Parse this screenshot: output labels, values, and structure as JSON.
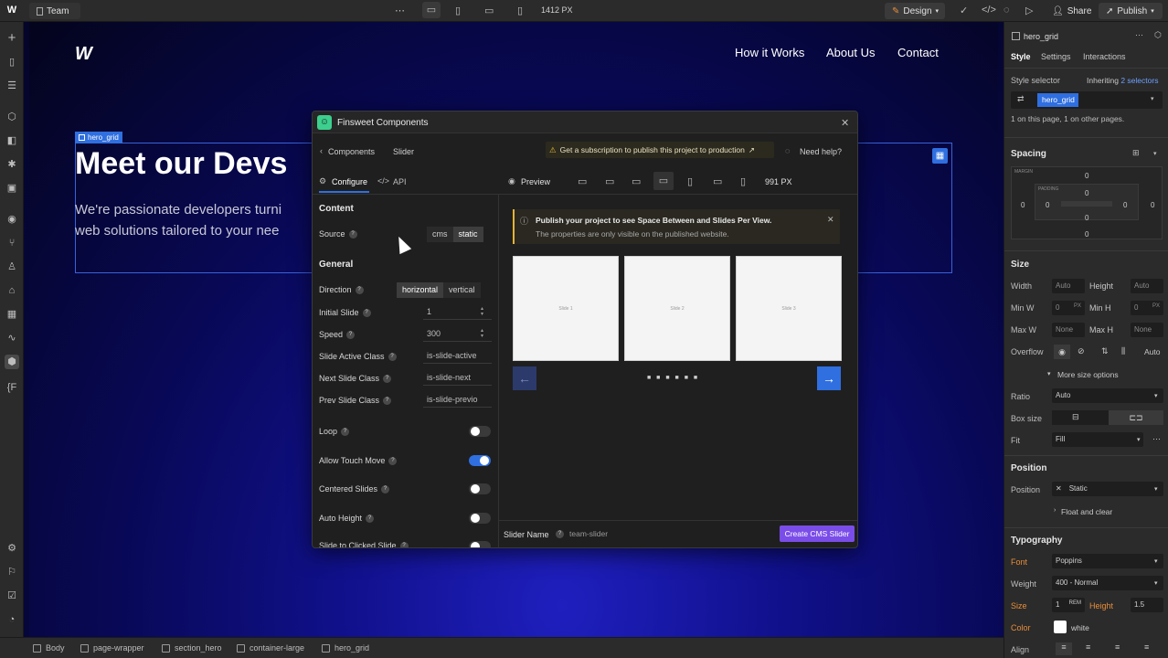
{
  "topbar": {
    "page_name": "Team",
    "width_readout": "1412 PX",
    "mode_label": "Design",
    "share_label": "Share",
    "publish_label": "Publish"
  },
  "site": {
    "nav": [
      "How it Works",
      "About Us",
      "Contact"
    ],
    "selection_badge": "hero_grid",
    "hero_title": "Meet our Devs",
    "hero_text_line1": "We're passionate developers turni",
    "hero_text_line2": "web solutions tailored to your nee"
  },
  "modal": {
    "title": "Finsweet Components",
    "breadcrumb_root": "Components",
    "breadcrumb_current": "Slider",
    "subscription_text": "Get a subscription to publish this project to production",
    "help_text": "Need help?",
    "tab_configure": "Configure",
    "tab_api": "API",
    "preview_label": "Preview",
    "preview_width": "991 PX",
    "content_heading": "Content",
    "source_label": "Source",
    "source_options": [
      "cms",
      "static"
    ],
    "source_selected": "static",
    "general_heading": "General",
    "direction_label": "Direction",
    "direction_options": [
      "horizontal",
      "vertical"
    ],
    "direction_selected": "horizontal",
    "fields": [
      {
        "label": "Initial Slide",
        "value": "1"
      },
      {
        "label": "Speed",
        "value": "300"
      },
      {
        "label": "Slide Active Class",
        "value": "is-slide-active"
      },
      {
        "label": "Next Slide Class",
        "value": "is-slide-next"
      },
      {
        "label": "Prev Slide Class",
        "value": "is-slide-previo"
      }
    ],
    "toggles": [
      {
        "label": "Loop",
        "on": false
      },
      {
        "label": "Allow Touch Move",
        "on": true
      },
      {
        "label": "Centered Slides",
        "on": false
      },
      {
        "label": "Auto Height",
        "on": false
      },
      {
        "label": "Slide to Clicked Slide",
        "on": false
      }
    ],
    "notice_title": "Publish your project to see Space Between and Slides Per View.",
    "notice_text": "The properties are only visible on the published website.",
    "slides": [
      "Slide 1",
      "Slide 2",
      "Slide 3"
    ],
    "slider_name_label": "Slider Name",
    "slider_name_value": "team-slider",
    "create_button": "Create CMS Slider"
  },
  "breadcrumbs": [
    "Body",
    "page-wrapper",
    "section_hero",
    "container-large",
    "hero_grid"
  ],
  "panel": {
    "element_name": "hero_grid",
    "tabs": [
      "Style",
      "Settings",
      "Interactions"
    ],
    "style_selector_label": "Style selector",
    "inheriting_text": "Inheriting",
    "inheriting_count": "2 selectors",
    "selector_chip": "hero_grid",
    "usage_text": "1 on this page, 1 on other pages.",
    "spacing_heading": "Spacing",
    "margin_label": "MARGIN",
    "padding_label": "PADDING",
    "spacing_values": [
      "0",
      "0",
      "0",
      "0",
      "0",
      "0",
      "0",
      "0"
    ],
    "size_heading": "Size",
    "width_label": "Width",
    "width_value": "Auto",
    "height_label": "Height",
    "height_value": "Auto",
    "minw_label": "Min W",
    "minw_value": "0",
    "minw_unit": "PX",
    "minh_label": "Min H",
    "minh_value": "0",
    "minh_unit": "PX",
    "maxw_label": "Max W",
    "maxw_value": "None",
    "maxh_label": "Max H",
    "maxh_value": "None",
    "overflow_label": "Overflow",
    "overflow_value": "Auto",
    "more_size": "More size options",
    "ratio_label": "Ratio",
    "ratio_value": "Auto",
    "boxsize_label": "Box size",
    "fit_label": "Fit",
    "fit_value": "Fill",
    "position_heading": "Position",
    "position_label": "Position",
    "position_value": "Static",
    "float_clear": "Float and clear",
    "typography_heading": "Typography",
    "font_label": "Font",
    "font_value": "Poppins",
    "weight_label": "Weight",
    "weight_value": "400 - Normal",
    "size_label": "Size",
    "size_value": "1",
    "size_unit": "REM",
    "lineheight_label": "Height",
    "lineheight_value": "1.5",
    "color_label": "Color",
    "color_value": "white",
    "align_label": "Align"
  },
  "colors": {
    "accent": "#2f6fe0",
    "create_button": "#7a4de8",
    "warning": "#e3b33a",
    "finsweet_logo": "#3ccf8e"
  }
}
